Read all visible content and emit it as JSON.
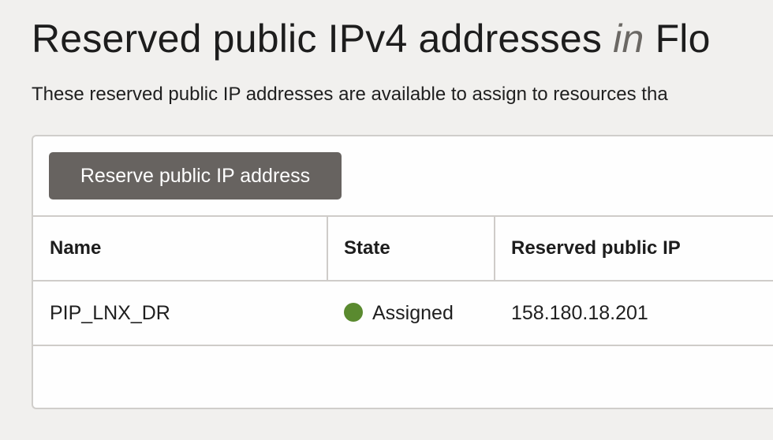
{
  "page": {
    "title_main": "Reserved public IPv4 addresses",
    "title_in": "in",
    "title_compartment": "Flo",
    "description": "These reserved public IP addresses are available to assign to resources tha"
  },
  "toolbar": {
    "reserve_button_label": "Reserve public IP address"
  },
  "table": {
    "columns": [
      "Name",
      "State",
      "Reserved public IP"
    ],
    "rows": [
      {
        "name": "PIP_LNX_DR",
        "state": "Assigned",
        "state_color": "#5a8a2f",
        "reserved_public_ip": "158.180.18.201"
      }
    ]
  },
  "colors": {
    "background": "#f1f0ee",
    "button": "#676360",
    "assigned_status": "#5a8a2f"
  }
}
